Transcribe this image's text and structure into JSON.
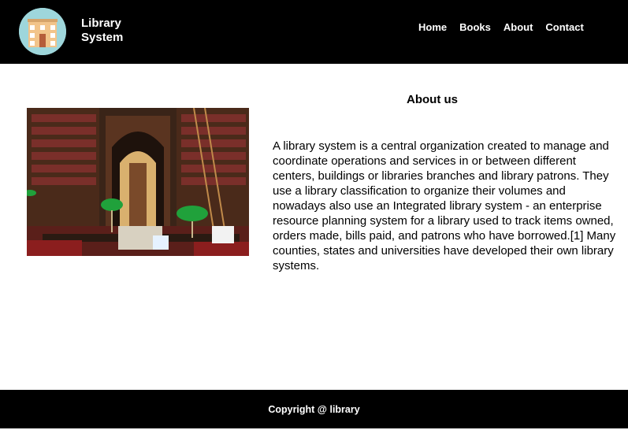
{
  "header": {
    "brand_line1": "Library",
    "brand_line2": "System",
    "nav": [
      "Home",
      "Books",
      "About",
      "Contact"
    ]
  },
  "main": {
    "title": "About us",
    "body": "A library system is a central organization created to manage and coordinate operations and services in or between different centers, buildings or libraries branches and library patrons. They use a library classification to organize their volumes and nowadays also use an Integrated library system - an enterprise resource planning system for a library used to track items owned, orders made, bills paid, and patrons who have borrowed.[1] Many counties, states and universities have developed their own library systems."
  },
  "footer": {
    "copyright": "Copyright @ library"
  },
  "colors": {
    "header_bg": "#000000",
    "footer_bg": "#000000",
    "logo_bg": "#9ed6db"
  },
  "icons": [
    "library-building-icon"
  ]
}
